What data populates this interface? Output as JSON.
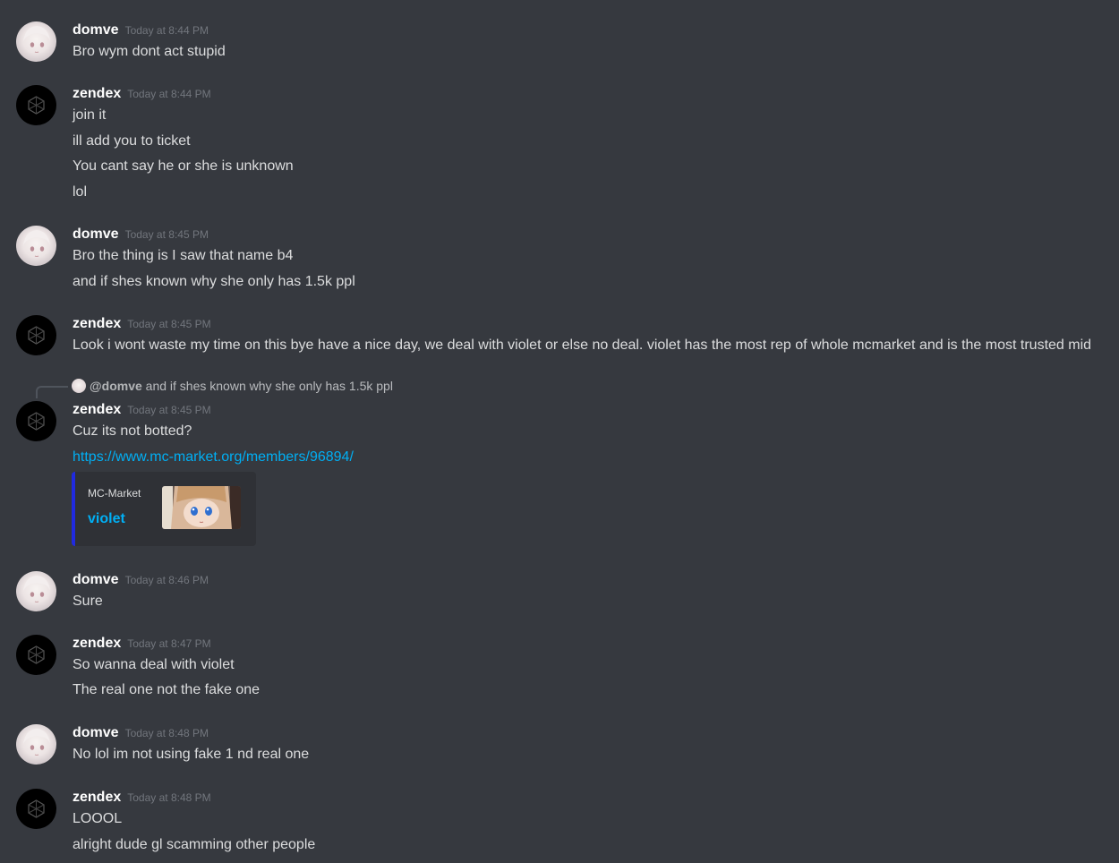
{
  "messages": [
    {
      "author": "domve",
      "timestamp": "Today at 8:44 PM",
      "lines": [
        "Bro wym dont act stupid"
      ]
    },
    {
      "author": "zendex",
      "timestamp": "Today at 8:44 PM",
      "lines": [
        "join it",
        "ill add you to ticket",
        "You cant say he or she is unknown",
        "lol"
      ]
    },
    {
      "author": "domve",
      "timestamp": "Today at 8:45 PM",
      "lines": [
        "Bro the thing is I saw that name b4",
        "and if shes known why she only has 1.5k ppl"
      ]
    },
    {
      "author": "zendex",
      "timestamp": "Today at 8:45 PM",
      "lines": [
        "Look i wont waste my time on this bye have a nice day, we deal with violet or else no deal. violet has the most rep of whole mcmarket and is the most trusted mid"
      ]
    },
    {
      "author": "zendex",
      "timestamp": "Today at 8:45 PM",
      "reply": {
        "mention": "@domve",
        "text": "and if shes known why she only has 1.5k ppl"
      },
      "lines": [
        "Cuz its not botted?"
      ],
      "link": "https://www.mc-market.org/members/96894/",
      "embed": {
        "provider": "MC-Market",
        "title": "violet",
        "accent": "#202ae0"
      }
    },
    {
      "author": "domve",
      "timestamp": "Today at 8:46 PM",
      "lines": [
        "Sure"
      ]
    },
    {
      "author": "zendex",
      "timestamp": "Today at 8:47 PM",
      "lines": [
        "So wanna deal with violet",
        "The real one not the fake one"
      ]
    },
    {
      "author": "domve",
      "timestamp": "Today at 8:48 PM",
      "lines": [
        "No lol im not using fake 1 nd real one"
      ]
    },
    {
      "author": "zendex",
      "timestamp": "Today at 8:48 PM",
      "lines": [
        "LOOOL",
        "alright dude gl scamming other people"
      ]
    }
  ],
  "colors": {
    "background": "#36393f",
    "username": "#ffffff",
    "timestamp": "#72767d",
    "text": "#dcddde",
    "link": "#00aff4",
    "embed_bg": "#2f3136"
  },
  "icons": {
    "zendex_avatar": "hexagon-cube-icon",
    "domve_avatar": "anime-avatar-icon"
  }
}
